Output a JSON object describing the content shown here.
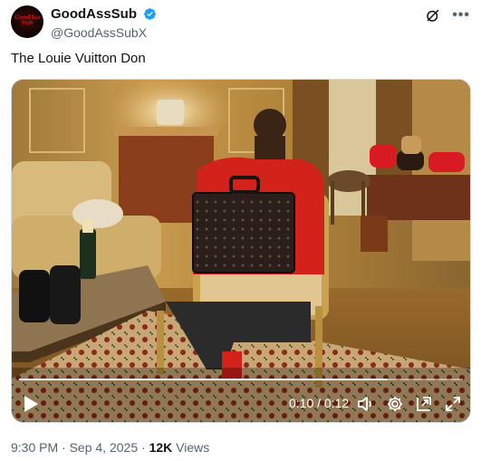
{
  "author": {
    "display_name": "GoodAssSub",
    "handle": "@GoodAssSubX",
    "verified": true
  },
  "tweet": {
    "text": "The Louie Vuitton Don"
  },
  "video": {
    "current_time": "0:10",
    "separator": "/",
    "duration": "0:12",
    "progress": 0.83
  },
  "meta": {
    "time": "9:30 PM",
    "date": "Sep 4, 2025",
    "views_count": "12K",
    "views_label": "Views"
  },
  "colors": {
    "verified": "#1d9bf0",
    "text_primary": "#0f1419",
    "text_secondary": "#536471"
  },
  "icons": {
    "header": [
      "grok-icon",
      "more-icon"
    ],
    "video_controls": [
      "play-icon",
      "volume-icon",
      "settings-icon",
      "pip-icon",
      "fullscreen-icon"
    ]
  }
}
